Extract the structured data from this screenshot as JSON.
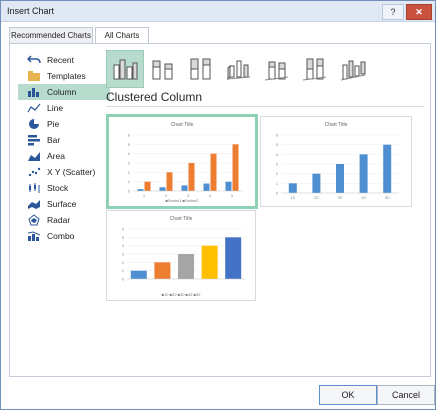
{
  "window": {
    "title": "Insert Chart",
    "help_label": "?",
    "close_label": "✕"
  },
  "tabs": [
    {
      "label": "Recommended Charts"
    },
    {
      "label": "All Charts"
    }
  ],
  "sidebar": {
    "items": [
      {
        "label": "Recent",
        "icon": "undo-arrow-icon"
      },
      {
        "label": "Templates",
        "icon": "folder-icon"
      },
      {
        "label": "Column",
        "icon": "column-chart-icon"
      },
      {
        "label": "Line",
        "icon": "line-chart-icon"
      },
      {
        "label": "Pie",
        "icon": "pie-chart-icon"
      },
      {
        "label": "Bar",
        "icon": "bar-chart-icon"
      },
      {
        "label": "Area",
        "icon": "area-chart-icon"
      },
      {
        "label": "X Y (Scatter)",
        "icon": "scatter-chart-icon"
      },
      {
        "label": "Stock",
        "icon": "stock-chart-icon"
      },
      {
        "label": "Surface",
        "icon": "surface-chart-icon"
      },
      {
        "label": "Radar",
        "icon": "radar-chart-icon"
      },
      {
        "label": "Combo",
        "icon": "combo-chart-icon"
      }
    ],
    "active_index": 2
  },
  "chart_types": [
    {
      "name": "Clustered Column",
      "icon": "clustered-column-icon"
    },
    {
      "name": "Stacked Column",
      "icon": "stacked-column-icon"
    },
    {
      "name": "100% Stacked Column",
      "icon": "percent-stacked-column-icon"
    },
    {
      "name": "3-D Clustered Column",
      "icon": "3d-clustered-column-icon"
    },
    {
      "name": "3-D Stacked Column",
      "icon": "3d-stacked-column-icon"
    },
    {
      "name": "3-D 100% Stacked Column",
      "icon": "3d-percent-stacked-column-icon"
    },
    {
      "name": "3-D Column",
      "icon": "3d-column-icon"
    }
  ],
  "section_title": "Clustered Column",
  "previews": {
    "p1": {
      "title": "Chart Title",
      "legend": "■Series1  ■Series2",
      "y_ticks": [
        "6",
        "5",
        "4",
        "3",
        "2",
        "1",
        "0"
      ],
      "x_ticks": [
        "1",
        "2",
        "3",
        "4",
        "5"
      ]
    },
    "p2": {
      "title": "Chart Title",
      "y_ticks": [
        "6",
        "5",
        "4",
        "3",
        "2",
        "1",
        "0"
      ],
      "x_ticks": [
        "10",
        "20",
        "30",
        "40",
        "50"
      ]
    },
    "p3": {
      "title": "Chart Title",
      "legend": "■10 ■20 ■30 ■40 ■50",
      "y_ticks": [
        "6",
        "5",
        "4",
        "3",
        "2",
        "1",
        "0"
      ]
    }
  },
  "buttons": {
    "ok": "OK",
    "cancel": "Cancel"
  },
  "colors": {
    "blue": "#4f8fd1",
    "orange": "#ed7d31",
    "gray": "#a5a5a5",
    "gold": "#ffc000",
    "royal": "#4472c4",
    "selection": "#8fd1b4"
  },
  "chart_data": [
    {
      "type": "bar",
      "title": "Chart Title",
      "categories": [
        "1",
        "2",
        "3",
        "4",
        "5"
      ],
      "series": [
        {
          "name": "Series1",
          "values": [
            0.2,
            0.4,
            0.6,
            0.8,
            1.0
          ]
        },
        {
          "name": "Series2",
          "values": [
            1,
            2,
            3,
            4,
            5
          ]
        }
      ],
      "ylim": [
        0,
        6
      ]
    },
    {
      "type": "bar",
      "title": "Chart Title",
      "categories": [
        "10",
        "20",
        "30",
        "40",
        "50"
      ],
      "series": [
        {
          "values": [
            1,
            2,
            3,
            4,
            5
          ]
        }
      ],
      "ylim": [
        0,
        6
      ]
    },
    {
      "type": "bar",
      "title": "Chart Title",
      "categories": [
        "10",
        "20",
        "30",
        "40",
        "50"
      ],
      "series": [
        {
          "name": "10",
          "values": [
            1
          ]
        },
        {
          "name": "20",
          "values": [
            2
          ]
        },
        {
          "name": "30",
          "values": [
            3
          ]
        },
        {
          "name": "40",
          "values": [
            4
          ]
        },
        {
          "name": "50",
          "values": [
            5
          ]
        }
      ],
      "ylim": [
        0,
        6
      ]
    }
  ]
}
